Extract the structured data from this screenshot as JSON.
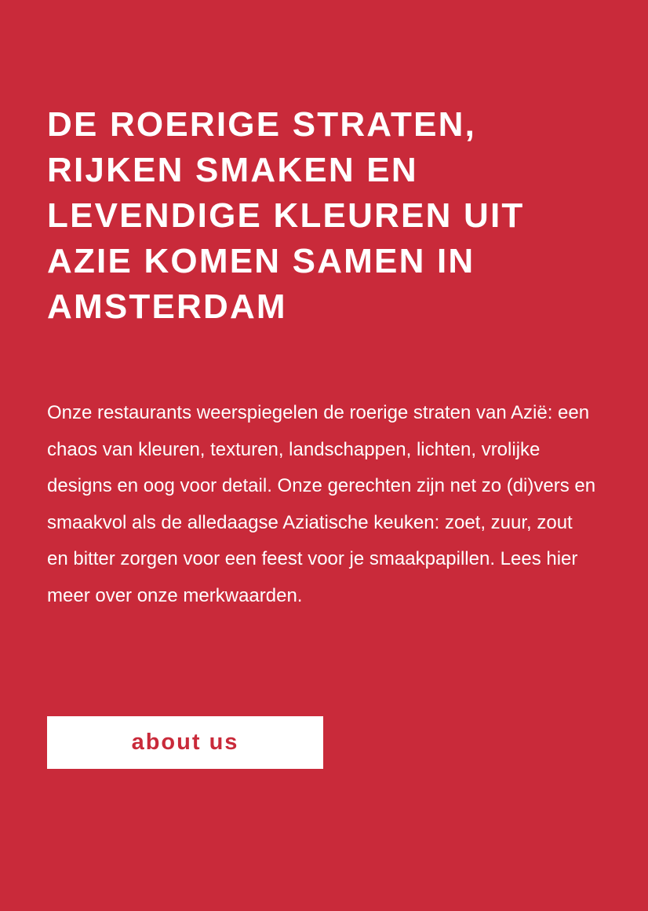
{
  "colors": {
    "background": "#c92a3a",
    "text": "#ffffff",
    "button_background": "#ffffff",
    "button_text": "#c92a3a"
  },
  "intro": {
    "headline": "DE ROERIGE STRATEN, RIJKEN SMAKEN EN LEVENDIGE KLEUREN UIT AZIE KOMEN SAMEN IN AMSTERDAM",
    "body": "Onze restaurants weerspiegelen de roerige straten van Azië: een chaos van kleuren, texturen, landschappen, lichten, vrolijke designs en oog voor detail. Onze gerechten zijn net zo (di)vers en smaakvol als de alledaagse Aziatische keuken: zoet, zuur, zout en bitter zorgen voor een feest voor je smaakpapillen. Lees hier meer over onze merkwaarden.",
    "cta_label": "about us"
  }
}
